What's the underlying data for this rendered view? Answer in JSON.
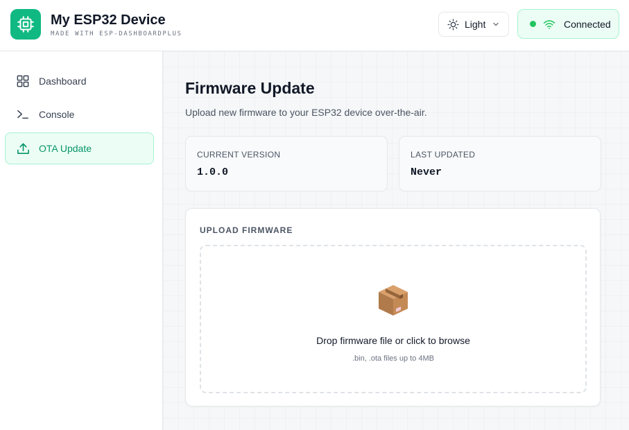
{
  "header": {
    "title": "My ESP32 Device",
    "subtitle": "MADE WITH ESP-DASHBOARDPLUS",
    "logo_icon": "chip-icon",
    "theme": {
      "label": "Light",
      "icon": "sun-icon"
    },
    "connection": {
      "label": "Connected",
      "icon": "wifi-icon",
      "color": "#22c55e"
    }
  },
  "sidebar": {
    "items": [
      {
        "label": "Dashboard",
        "icon": "grid-icon",
        "active": false
      },
      {
        "label": "Console",
        "icon": "terminal-icon",
        "active": false
      },
      {
        "label": "OTA Update",
        "icon": "upload-icon",
        "active": true
      }
    ]
  },
  "main": {
    "title": "Firmware Update",
    "description": "Upload new firmware to your ESP32 device over-the-air.",
    "current_version": {
      "label": "CURRENT VERSION",
      "value": "1.0.0"
    },
    "last_updated": {
      "label": "LAST UPDATED",
      "value": "Never"
    },
    "upload": {
      "section_label": "UPLOAD FIRMWARE",
      "icon": "package-icon",
      "prompt": "Drop firmware file or click to browse",
      "hint": ".bin, .ota files up to 4MB"
    }
  },
  "colors": {
    "accent": "#10b981",
    "accent_text": "#059669",
    "accent_bg": "#ecfdf5"
  }
}
